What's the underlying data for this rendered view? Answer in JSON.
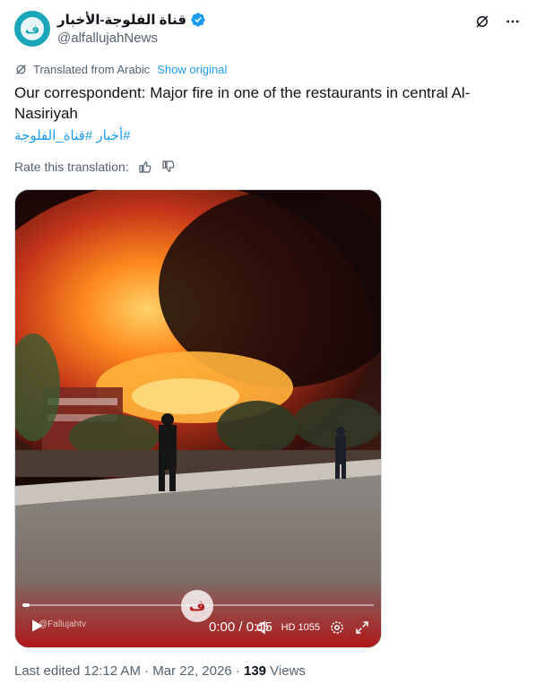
{
  "author": {
    "display_name": "قناة الفلوجة-الأخبار",
    "handle": "@alfallujahNews",
    "avatar_letter": "ف"
  },
  "translation": {
    "label": "Translated from Arabic",
    "show_original": "Show original"
  },
  "tweet": {
    "text": "Our correspondent: Major fire in one of the restaurants in central Al-Nasiriyah",
    "hashtags": "#أخبار #قناة_الفلوجة"
  },
  "rate": {
    "label": "Rate this translation:"
  },
  "video": {
    "time": "0:00 / 0:15",
    "watermark": "@Fallujahtv",
    "hd_label": "HD 1055",
    "progress": 0.02
  },
  "meta": {
    "edited": "Last edited 12:12 AM · Mar 22, 2026 · ",
    "views_count": "139",
    "views_label": " Views"
  },
  "colors": {
    "accent": "#1d9bf0",
    "muted": "#536471",
    "text": "#0f1419"
  }
}
